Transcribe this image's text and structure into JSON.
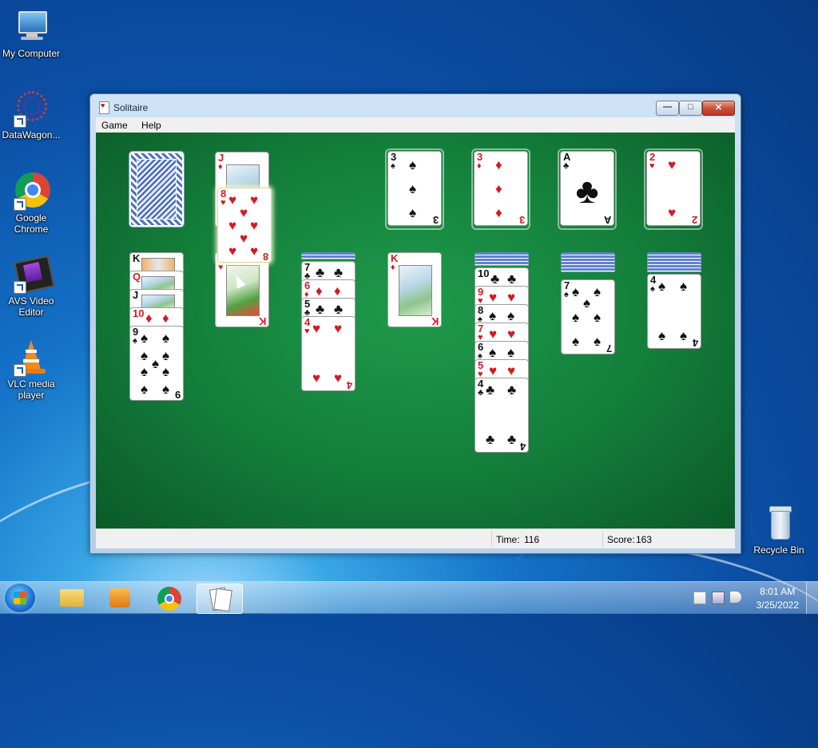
{
  "desktop": {
    "icons": [
      {
        "label": "My Computer"
      },
      {
        "label": "DataWagon..."
      },
      {
        "label": "Google Chrome"
      },
      {
        "label": "AVS Video Editor"
      },
      {
        "label": "VLC media player"
      },
      {
        "label": "Recycle Bin"
      }
    ]
  },
  "window": {
    "title": "Solitaire",
    "controls": {
      "minimize": "—",
      "maximize": "□",
      "close": "✕"
    },
    "menu": [
      "Game",
      "Help"
    ],
    "status": {
      "time_label": "Time:",
      "time_value": "116",
      "score_label": "Score:",
      "score_value": "163"
    }
  },
  "game": {
    "foundations": [
      {
        "rank": "3",
        "suit": "♠",
        "color": "black"
      },
      {
        "rank": "3",
        "suit": "♦",
        "color": "red"
      },
      {
        "rank": "A",
        "suit": "♣",
        "color": "black"
      },
      {
        "rank": "2",
        "suit": "♥",
        "color": "red"
      }
    ],
    "waste_top": {
      "rank": "J",
      "suit": "♦",
      "color": "red"
    },
    "dragging_card": {
      "rank": "8",
      "suit": "♥",
      "color": "red"
    },
    "tableau": [
      {
        "cards": [
          {
            "rank": "K",
            "suit": "♠",
            "color": "black"
          },
          {
            "rank": "Q",
            "suit": "♥",
            "color": "red"
          },
          {
            "rank": "J",
            "suit": "♠",
            "color": "black"
          },
          {
            "rank": "10",
            "suit": "♦",
            "color": "red"
          },
          {
            "rank": "9",
            "suit": "♠",
            "color": "black"
          }
        ]
      },
      {
        "cards": [
          {
            "rank": "K",
            "suit": "♥",
            "color": "red"
          }
        ]
      },
      {
        "cards": [
          {
            "rank": "7",
            "suit": "♣",
            "color": "black"
          },
          {
            "rank": "6",
            "suit": "♦",
            "color": "red"
          },
          {
            "rank": "5",
            "suit": "♣",
            "color": "black"
          },
          {
            "rank": "4",
            "suit": "♥",
            "color": "red"
          }
        ]
      },
      {
        "cards": [
          {
            "rank": "K",
            "suit": "♦",
            "color": "red"
          }
        ]
      },
      {
        "cards": [
          {
            "rank": "10",
            "suit": "♣",
            "color": "black"
          },
          {
            "rank": "9",
            "suit": "♥",
            "color": "red"
          },
          {
            "rank": "8",
            "suit": "♠",
            "color": "black"
          },
          {
            "rank": "7",
            "suit": "♥",
            "color": "red"
          },
          {
            "rank": "6",
            "suit": "♠",
            "color": "black"
          },
          {
            "rank": "5",
            "suit": "♥",
            "color": "red"
          },
          {
            "rank": "4",
            "suit": "♣",
            "color": "black"
          }
        ]
      },
      {
        "cards": [
          {
            "rank": "7",
            "suit": "♠",
            "color": "black"
          }
        ]
      },
      {
        "cards": [
          {
            "rank": "4",
            "suit": "♠",
            "color": "black"
          }
        ]
      }
    ]
  },
  "taskbar": {
    "clock_time": "8:01 AM",
    "clock_date": "3/25/2022"
  }
}
